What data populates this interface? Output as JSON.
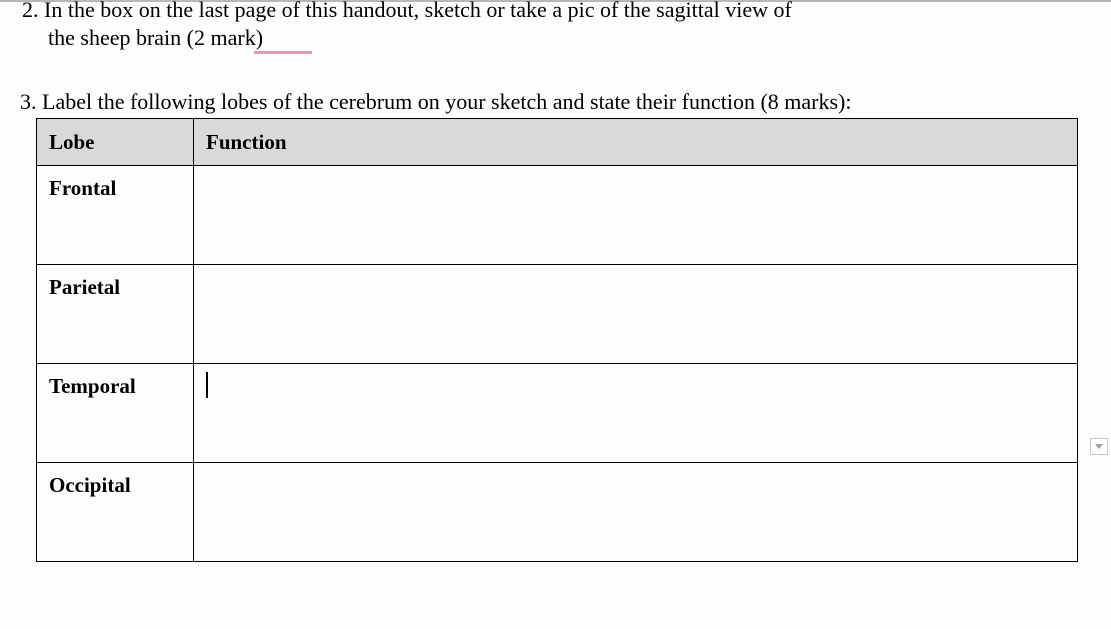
{
  "q2": {
    "line1": "2. In the box on the last page of this handout, sketch or take a pic of the sagittal view of",
    "line2": "the sheep brain  (2 mark)"
  },
  "q3": {
    "text": "3. Label the following lobes of the cerebrum on your sketch and state their function (8 marks):"
  },
  "table": {
    "headers": {
      "c1": "Lobe",
      "c2": "Function"
    },
    "rows": [
      {
        "lobe": "Frontal",
        "func": ""
      },
      {
        "lobe": "Parietal",
        "func": ""
      },
      {
        "lobe": "Temporal",
        "func": ""
      },
      {
        "lobe": "Occipital",
        "func": ""
      }
    ]
  }
}
